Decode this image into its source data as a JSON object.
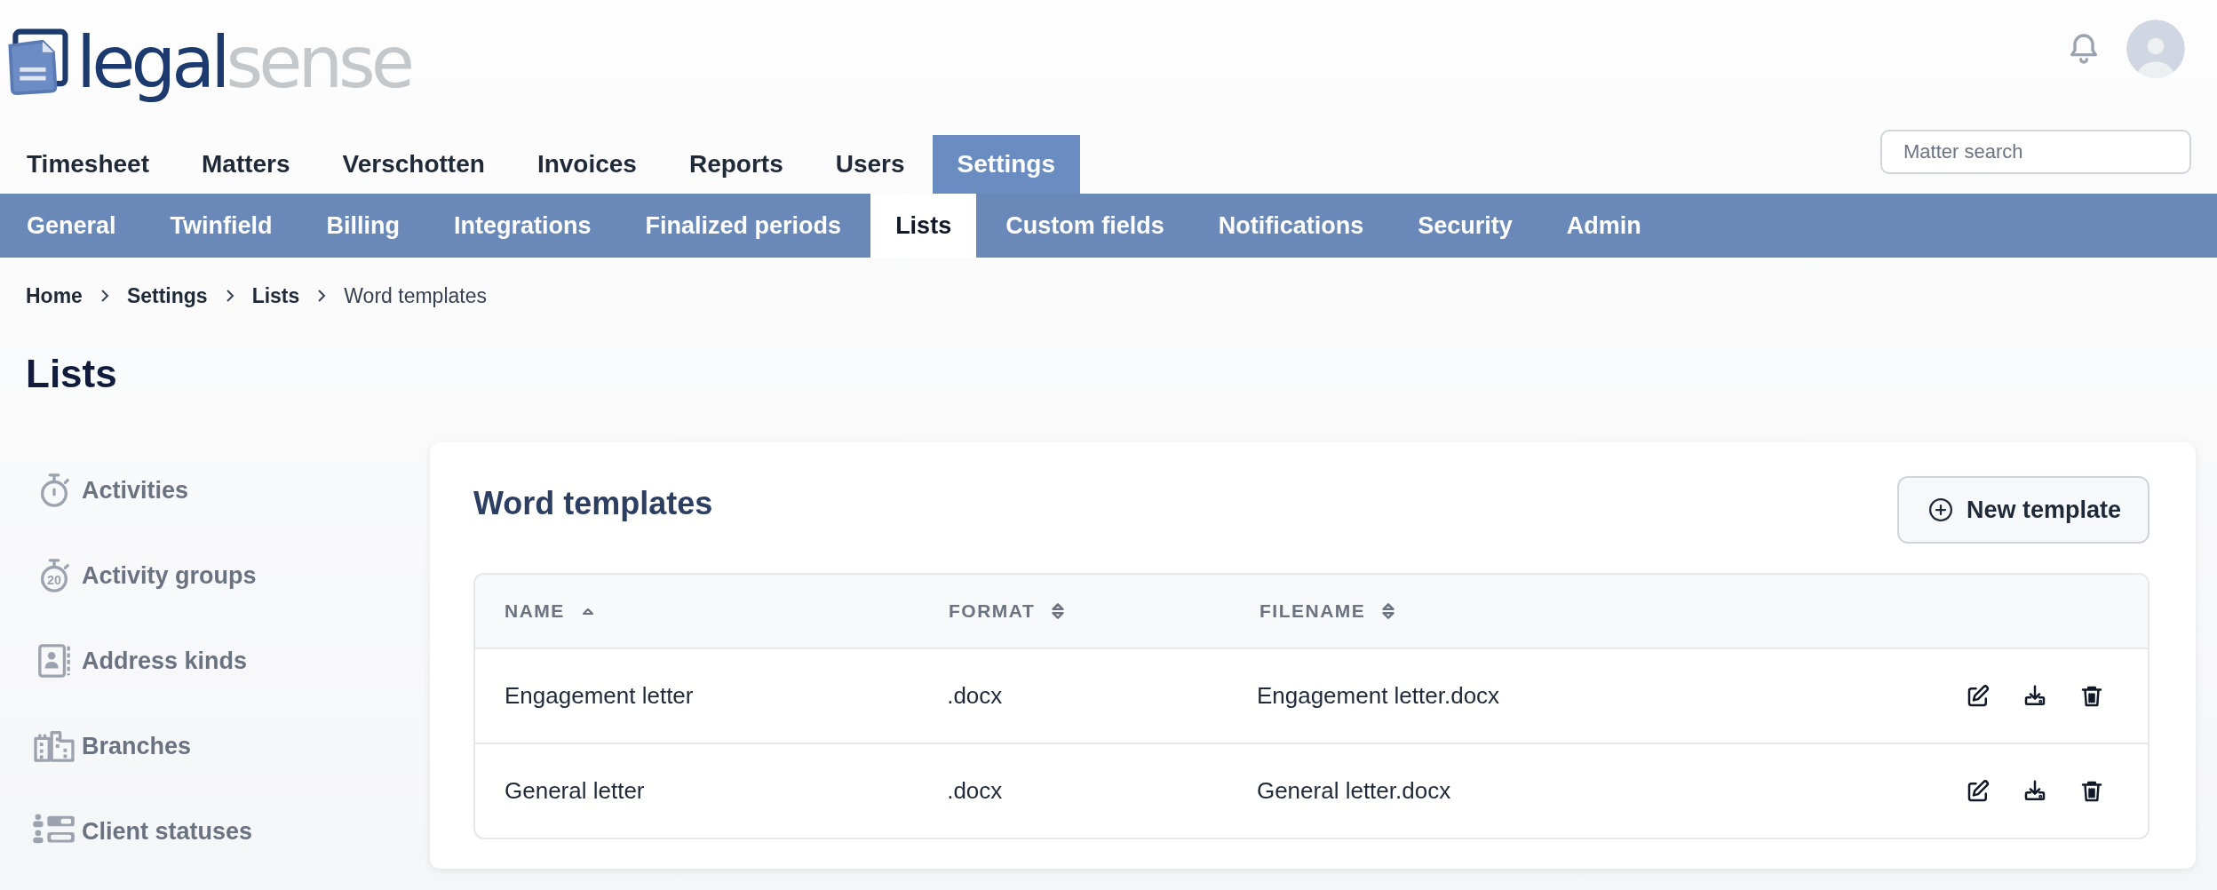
{
  "logo": {
    "primary": "legal",
    "secondary": "sense"
  },
  "search": {
    "placeholder": "Matter search"
  },
  "main_nav": [
    {
      "label": "Timesheet",
      "selected": false
    },
    {
      "label": "Matters",
      "selected": false
    },
    {
      "label": "Verschotten",
      "selected": false
    },
    {
      "label": "Invoices",
      "selected": false
    },
    {
      "label": "Reports",
      "selected": false
    },
    {
      "label": "Users",
      "selected": false
    },
    {
      "label": "Settings",
      "selected": true
    }
  ],
  "sub_nav": [
    {
      "label": "General",
      "selected": false
    },
    {
      "label": "Twinfield",
      "selected": false
    },
    {
      "label": "Billing",
      "selected": false
    },
    {
      "label": "Integrations",
      "selected": false
    },
    {
      "label": "Finalized periods",
      "selected": false
    },
    {
      "label": "Lists",
      "selected": true
    },
    {
      "label": "Custom fields",
      "selected": false
    },
    {
      "label": "Notifications",
      "selected": false
    },
    {
      "label": "Security",
      "selected": false
    },
    {
      "label": "Admin",
      "selected": false
    }
  ],
  "breadcrumb": [
    {
      "label": "Home",
      "current": false
    },
    {
      "label": "Settings",
      "current": false
    },
    {
      "label": "Lists",
      "current": false
    },
    {
      "label": "Word templates",
      "current": true
    }
  ],
  "page_title": "Lists",
  "sidebar": {
    "items": [
      {
        "label": "Activities",
        "kind": "stopwatch"
      },
      {
        "label": "Activity groups",
        "kind": "stopwatch-number",
        "icon_text": "20"
      },
      {
        "label": "Address kinds",
        "kind": "contact-card"
      },
      {
        "label": "Branches",
        "kind": "buildings"
      },
      {
        "label": "Client statuses",
        "kind": "status-list"
      }
    ]
  },
  "card": {
    "title": "Word templates",
    "new_button": "New template",
    "table": {
      "columns": [
        {
          "label": "NAME",
          "sorted_ascending": true
        },
        {
          "label": "FORMAT",
          "sorted_ascending": false
        },
        {
          "label": "FILENAME",
          "sorted_ascending": false
        }
      ],
      "rows": [
        {
          "name": "Engagement letter",
          "format": ".docx",
          "filename": "Engagement letter.docx"
        },
        {
          "name": "General letter",
          "format": ".docx",
          "filename": "General letter.docx"
        }
      ]
    }
  }
}
